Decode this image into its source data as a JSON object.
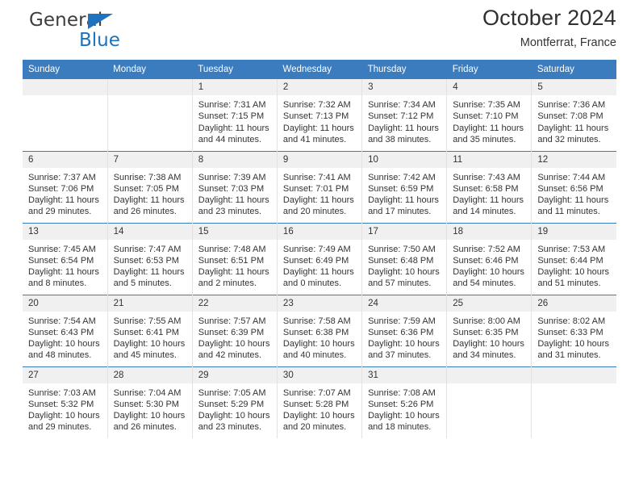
{
  "brand": {
    "name_top": "General",
    "name_bottom": "Blue",
    "triangle_color": "#1f72bd",
    "top_color": "#3d3d3d"
  },
  "header": {
    "title": "October 2024",
    "subtitle": "Montferrat, France"
  },
  "theme": {
    "header_blue": "#3b7cbe",
    "daynum_band": "#f0f0f0",
    "text": "#333333"
  },
  "weekday_headers": [
    "Sunday",
    "Monday",
    "Tuesday",
    "Wednesday",
    "Thursday",
    "Friday",
    "Saturday"
  ],
  "weeks": [
    [
      {
        "day": "",
        "sunrise": "",
        "sunset": "",
        "daylight1": "",
        "daylight2": ""
      },
      {
        "day": "",
        "sunrise": "",
        "sunset": "",
        "daylight1": "",
        "daylight2": ""
      },
      {
        "day": "1",
        "sunrise": "Sunrise: 7:31 AM",
        "sunset": "Sunset: 7:15 PM",
        "daylight1": "Daylight: 11 hours",
        "daylight2": "and 44 minutes."
      },
      {
        "day": "2",
        "sunrise": "Sunrise: 7:32 AM",
        "sunset": "Sunset: 7:13 PM",
        "daylight1": "Daylight: 11 hours",
        "daylight2": "and 41 minutes."
      },
      {
        "day": "3",
        "sunrise": "Sunrise: 7:34 AM",
        "sunset": "Sunset: 7:12 PM",
        "daylight1": "Daylight: 11 hours",
        "daylight2": "and 38 minutes."
      },
      {
        "day": "4",
        "sunrise": "Sunrise: 7:35 AM",
        "sunset": "Sunset: 7:10 PM",
        "daylight1": "Daylight: 11 hours",
        "daylight2": "and 35 minutes."
      },
      {
        "day": "5",
        "sunrise": "Sunrise: 7:36 AM",
        "sunset": "Sunset: 7:08 PM",
        "daylight1": "Daylight: 11 hours",
        "daylight2": "and 32 minutes."
      }
    ],
    [
      {
        "day": "6",
        "sunrise": "Sunrise: 7:37 AM",
        "sunset": "Sunset: 7:06 PM",
        "daylight1": "Daylight: 11 hours",
        "daylight2": "and 29 minutes."
      },
      {
        "day": "7",
        "sunrise": "Sunrise: 7:38 AM",
        "sunset": "Sunset: 7:05 PM",
        "daylight1": "Daylight: 11 hours",
        "daylight2": "and 26 minutes."
      },
      {
        "day": "8",
        "sunrise": "Sunrise: 7:39 AM",
        "sunset": "Sunset: 7:03 PM",
        "daylight1": "Daylight: 11 hours",
        "daylight2": "and 23 minutes."
      },
      {
        "day": "9",
        "sunrise": "Sunrise: 7:41 AM",
        "sunset": "Sunset: 7:01 PM",
        "daylight1": "Daylight: 11 hours",
        "daylight2": "and 20 minutes."
      },
      {
        "day": "10",
        "sunrise": "Sunrise: 7:42 AM",
        "sunset": "Sunset: 6:59 PM",
        "daylight1": "Daylight: 11 hours",
        "daylight2": "and 17 minutes."
      },
      {
        "day": "11",
        "sunrise": "Sunrise: 7:43 AM",
        "sunset": "Sunset: 6:58 PM",
        "daylight1": "Daylight: 11 hours",
        "daylight2": "and 14 minutes."
      },
      {
        "day": "12",
        "sunrise": "Sunrise: 7:44 AM",
        "sunset": "Sunset: 6:56 PM",
        "daylight1": "Daylight: 11 hours",
        "daylight2": "and 11 minutes."
      }
    ],
    [
      {
        "day": "13",
        "sunrise": "Sunrise: 7:45 AM",
        "sunset": "Sunset: 6:54 PM",
        "daylight1": "Daylight: 11 hours",
        "daylight2": "and 8 minutes."
      },
      {
        "day": "14",
        "sunrise": "Sunrise: 7:47 AM",
        "sunset": "Sunset: 6:53 PM",
        "daylight1": "Daylight: 11 hours",
        "daylight2": "and 5 minutes."
      },
      {
        "day": "15",
        "sunrise": "Sunrise: 7:48 AM",
        "sunset": "Sunset: 6:51 PM",
        "daylight1": "Daylight: 11 hours",
        "daylight2": "and 2 minutes."
      },
      {
        "day": "16",
        "sunrise": "Sunrise: 7:49 AM",
        "sunset": "Sunset: 6:49 PM",
        "daylight1": "Daylight: 11 hours",
        "daylight2": "and 0 minutes."
      },
      {
        "day": "17",
        "sunrise": "Sunrise: 7:50 AM",
        "sunset": "Sunset: 6:48 PM",
        "daylight1": "Daylight: 10 hours",
        "daylight2": "and 57 minutes."
      },
      {
        "day": "18",
        "sunrise": "Sunrise: 7:52 AM",
        "sunset": "Sunset: 6:46 PM",
        "daylight1": "Daylight: 10 hours",
        "daylight2": "and 54 minutes."
      },
      {
        "day": "19",
        "sunrise": "Sunrise: 7:53 AM",
        "sunset": "Sunset: 6:44 PM",
        "daylight1": "Daylight: 10 hours",
        "daylight2": "and 51 minutes."
      }
    ],
    [
      {
        "day": "20",
        "sunrise": "Sunrise: 7:54 AM",
        "sunset": "Sunset: 6:43 PM",
        "daylight1": "Daylight: 10 hours",
        "daylight2": "and 48 minutes."
      },
      {
        "day": "21",
        "sunrise": "Sunrise: 7:55 AM",
        "sunset": "Sunset: 6:41 PM",
        "daylight1": "Daylight: 10 hours",
        "daylight2": "and 45 minutes."
      },
      {
        "day": "22",
        "sunrise": "Sunrise: 7:57 AM",
        "sunset": "Sunset: 6:39 PM",
        "daylight1": "Daylight: 10 hours",
        "daylight2": "and 42 minutes."
      },
      {
        "day": "23",
        "sunrise": "Sunrise: 7:58 AM",
        "sunset": "Sunset: 6:38 PM",
        "daylight1": "Daylight: 10 hours",
        "daylight2": "and 40 minutes."
      },
      {
        "day": "24",
        "sunrise": "Sunrise: 7:59 AM",
        "sunset": "Sunset: 6:36 PM",
        "daylight1": "Daylight: 10 hours",
        "daylight2": "and 37 minutes."
      },
      {
        "day": "25",
        "sunrise": "Sunrise: 8:00 AM",
        "sunset": "Sunset: 6:35 PM",
        "daylight1": "Daylight: 10 hours",
        "daylight2": "and 34 minutes."
      },
      {
        "day": "26",
        "sunrise": "Sunrise: 8:02 AM",
        "sunset": "Sunset: 6:33 PM",
        "daylight1": "Daylight: 10 hours",
        "daylight2": "and 31 minutes."
      }
    ],
    [
      {
        "day": "27",
        "sunrise": "Sunrise: 7:03 AM",
        "sunset": "Sunset: 5:32 PM",
        "daylight1": "Daylight: 10 hours",
        "daylight2": "and 29 minutes."
      },
      {
        "day": "28",
        "sunrise": "Sunrise: 7:04 AM",
        "sunset": "Sunset: 5:30 PM",
        "daylight1": "Daylight: 10 hours",
        "daylight2": "and 26 minutes."
      },
      {
        "day": "29",
        "sunrise": "Sunrise: 7:05 AM",
        "sunset": "Sunset: 5:29 PM",
        "daylight1": "Daylight: 10 hours",
        "daylight2": "and 23 minutes."
      },
      {
        "day": "30",
        "sunrise": "Sunrise: 7:07 AM",
        "sunset": "Sunset: 5:28 PM",
        "daylight1": "Daylight: 10 hours",
        "daylight2": "and 20 minutes."
      },
      {
        "day": "31",
        "sunrise": "Sunrise: 7:08 AM",
        "sunset": "Sunset: 5:26 PM",
        "daylight1": "Daylight: 10 hours",
        "daylight2": "and 18 minutes."
      },
      {
        "day": "",
        "sunrise": "",
        "sunset": "",
        "daylight1": "",
        "daylight2": ""
      },
      {
        "day": "",
        "sunrise": "",
        "sunset": "",
        "daylight1": "",
        "daylight2": ""
      }
    ]
  ]
}
